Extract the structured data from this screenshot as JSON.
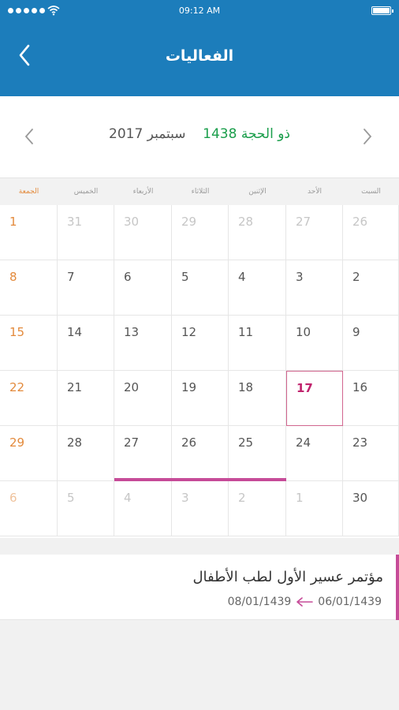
{
  "status": {
    "time": "09:12 AM"
  },
  "header": {
    "title": "الفعاليات",
    "color": "#1c7dbb"
  },
  "month": {
    "hijri": "ذو الحجة 1438",
    "gregorian": "سبتمبر 2017"
  },
  "weekdays": [
    "السبت",
    "الأحد",
    "الإثنين",
    "الثلاثاء",
    "الأربعاء",
    "الخميس",
    "الجمعة"
  ],
  "calendar": {
    "today": "17",
    "rows": [
      [
        "26",
        "27",
        "28",
        "29",
        "30",
        "31",
        "1"
      ],
      [
        "2",
        "3",
        "4",
        "5",
        "6",
        "7",
        "8"
      ],
      [
        "9",
        "10",
        "11",
        "12",
        "13",
        "14",
        "15"
      ],
      [
        "16",
        "17",
        "18",
        "19",
        "20",
        "21",
        "22"
      ],
      [
        "23",
        "24",
        "25",
        "26",
        "27",
        "28",
        "29"
      ],
      [
        "30",
        "1",
        "2",
        "3",
        "4",
        "5",
        "6"
      ]
    ]
  },
  "event": {
    "title": "مؤتمر عسير الأول لطب الأطفال",
    "start_date": "06/01/1439",
    "end_date": "08/01/1439",
    "accent_color": "#c64b98"
  }
}
